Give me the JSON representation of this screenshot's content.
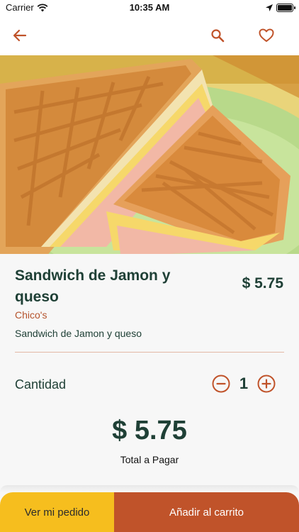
{
  "status_bar": {
    "carrier": "Carrier",
    "time": "10:35 AM"
  },
  "navbar": {
    "back_icon": "arrow-left-icon",
    "search_icon": "search-icon",
    "favorite_icon": "heart-outline-icon"
  },
  "product": {
    "image_description_icon": "sandwich-photo",
    "name": "Sandwich de Jamon y queso",
    "price": "$ 5.75",
    "restaurant": "Chico's",
    "description": "Sandwich de Jamon y queso"
  },
  "quantity": {
    "label": "Cantidad",
    "value": "1",
    "decrement_icon": "minus-circle-icon",
    "increment_icon": "plus-circle-icon"
  },
  "total": {
    "amount": "$ 5.75",
    "label": "Total a Pagar"
  },
  "footer": {
    "view_order_label": "Ver mi pedido",
    "add_to_cart_label": "Añadir al carrito"
  },
  "colors": {
    "accent": "#c0532a",
    "primary_text": "#1f4036",
    "secondary_button": "#f6be1e"
  }
}
